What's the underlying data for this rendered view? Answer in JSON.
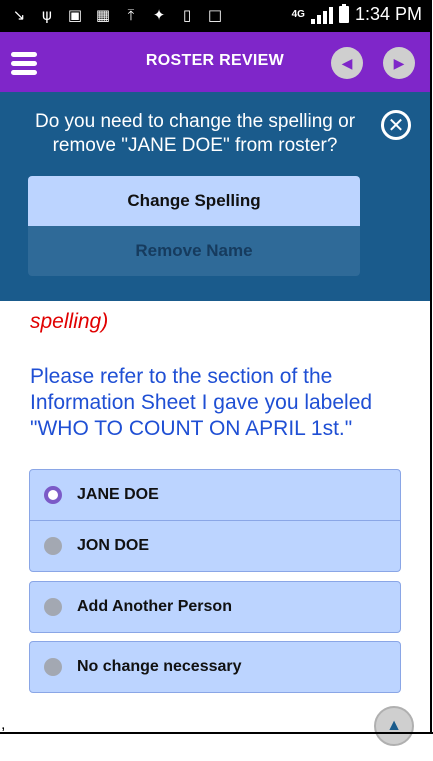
{
  "status_bar": {
    "time": "1:34 PM",
    "network": "4G",
    "icons": [
      "missed-call-icon",
      "usb-icon",
      "image-icon",
      "apps-icon",
      "upload-icon",
      "game-icon",
      "battery-100-icon",
      "cast-icon"
    ]
  },
  "app_bar": {
    "title": "ROSTER REVIEW",
    "back_icon": "chevron-left-icon",
    "forward_icon": "chevron-right-icon"
  },
  "popup": {
    "question": "Do you need to change the spelling or remove \"JANE DOE\" from roster?",
    "change_spelling_label": "Change Spelling",
    "remove_name_label": "Remove Name",
    "close_icon": "close-circle-icon"
  },
  "main": {
    "partial_text": "spelling)",
    "instruction": "Please refer to the section of the Information Sheet I gave you labeled \"WHO TO COUNT ON APRIL 1st.\"",
    "roster": [
      {
        "label": "JANE DOE",
        "selected": true
      },
      {
        "label": "JON DOE",
        "selected": false
      }
    ],
    "add_person_label": "Add Another Person",
    "no_change_label": "No change necessary"
  },
  "colors": {
    "app_bar": "#7f26c9",
    "popup_bg": "#1a5b8c",
    "option_bg": "#bcd4ff",
    "instruction_text": "#1f4fd4",
    "error_text": "#e00000"
  }
}
